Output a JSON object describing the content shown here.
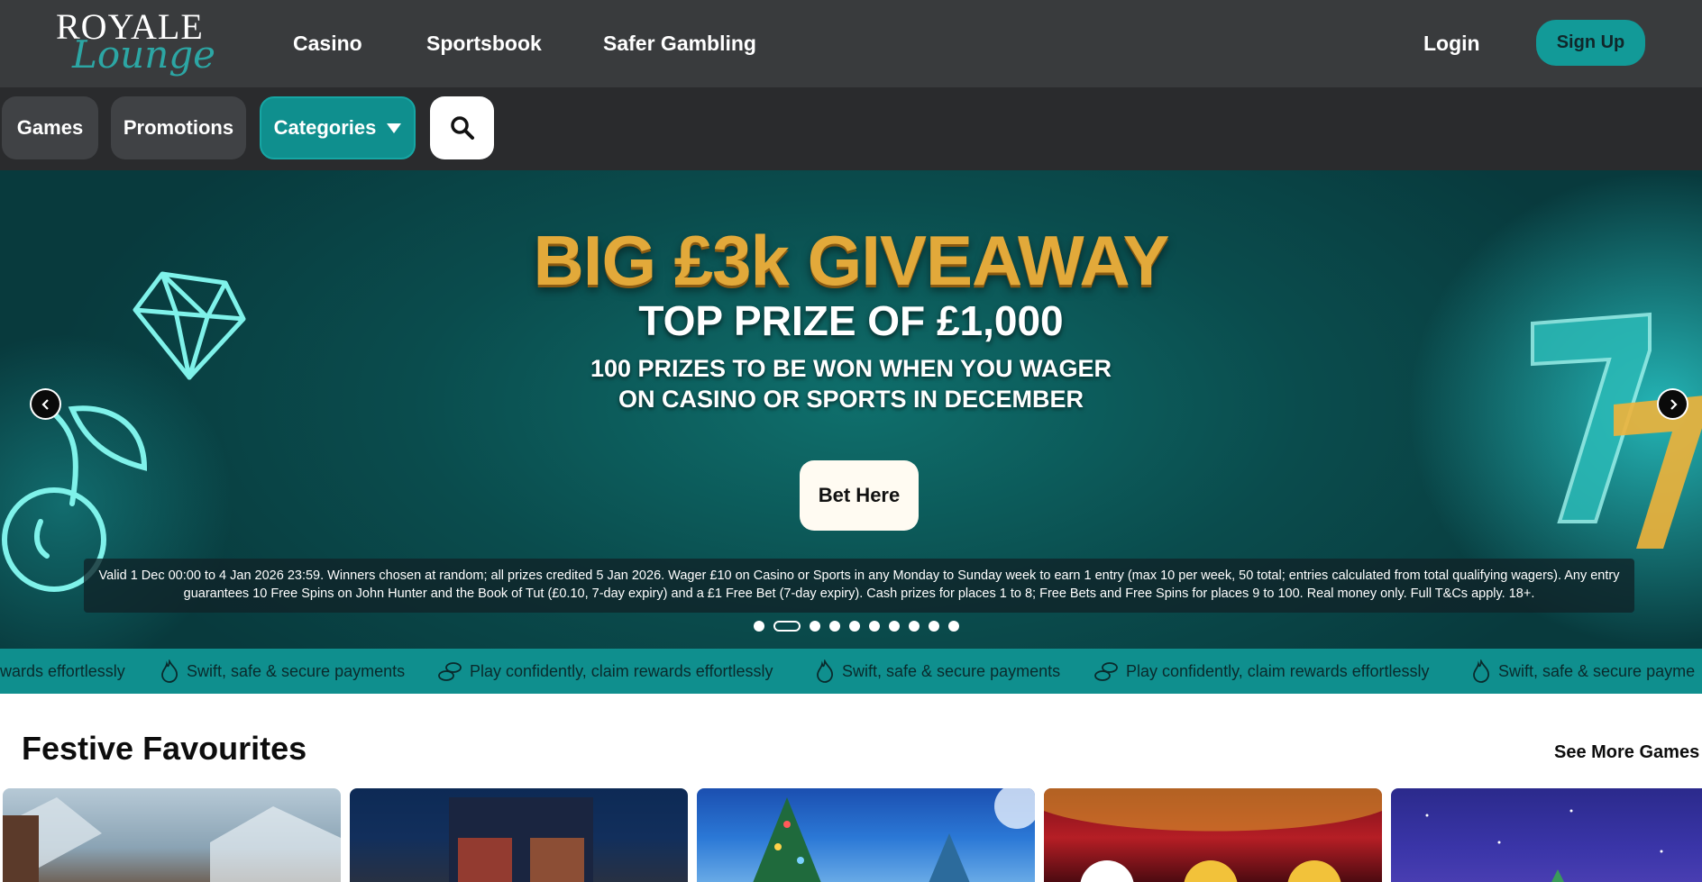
{
  "logo": {
    "line1": "ROYALE",
    "line2": "Lounge"
  },
  "topnav": {
    "items": [
      {
        "label": "Casino"
      },
      {
        "label": "Sportsbook"
      },
      {
        "label": "Safer Gambling"
      }
    ],
    "login_label": "Login",
    "signup_label": "Sign Up"
  },
  "catbar": {
    "games_label": "Games",
    "promotions_label": "Promotions",
    "categories_label": "Categories",
    "search_icon": "search-icon"
  },
  "hero": {
    "title": "BIG £3k GIVEAWAY",
    "subtitle": "TOP PRIZE OF £1,000",
    "line1": "100 PRIZES TO BE WON WHEN YOU WAGER",
    "line2": "ON CASINO OR SPORTS IN DECEMBER",
    "cta_label": "Bet Here",
    "terms": "Valid 1 Dec 00:00 to 4 Jan 2026 23:59. Winners chosen at random; all prizes credited 5 Jan 2026. Wager £10 on Casino or Sports in any Monday to Sunday week to earn 1 entry (max 10 per week, 50 total; entries calculated from total qualifying wagers). Any entry guarantees 10 Free Spins on John Hunter and the Book of Tut (£0.10, 7-day expiry) and a £1 Free Bet (7-day expiry). Cash prizes for places 1 to 8; Free Bets and Free Spins for places 9 to 100. Real money only. Full T&Cs apply. 18+.",
    "slide_count": 10,
    "active_slide": 2,
    "colors": {
      "accent": "#0f8f8e",
      "gold": "#e2a93a"
    }
  },
  "ticker": {
    "items": [
      {
        "text": "wards effortlessly",
        "icon": ""
      },
      {
        "text": "Swift, safe & secure payments",
        "icon": "flame-icon"
      },
      {
        "text": "Play confidently, claim rewards effortlessly",
        "icon": "coins-icon"
      },
      {
        "text": "Swift, safe & secure payments",
        "icon": "flame-icon"
      },
      {
        "text": "Play confidently, claim rewards effortlessly",
        "icon": "coins-icon"
      },
      {
        "text": "Swift, safe & secure payme",
        "icon": "flame-icon"
      }
    ]
  },
  "section": {
    "title": "Festive Favourites",
    "see_more_label": "See More Games"
  }
}
